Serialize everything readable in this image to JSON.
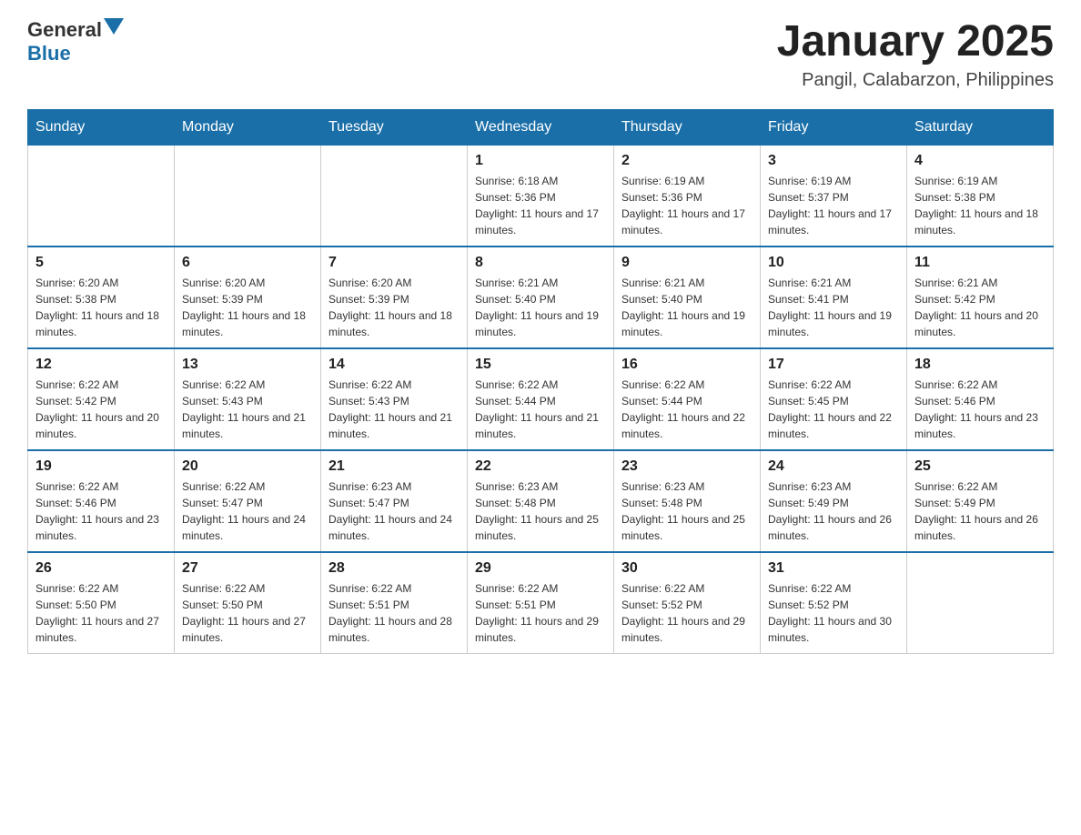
{
  "header": {
    "logo_general": "General",
    "logo_blue": "Blue",
    "month_title": "January 2025",
    "location": "Pangil, Calabarzon, Philippines"
  },
  "days_of_week": [
    "Sunday",
    "Monday",
    "Tuesday",
    "Wednesday",
    "Thursday",
    "Friday",
    "Saturday"
  ],
  "weeks": [
    {
      "cells": [
        {
          "day": "",
          "info": ""
        },
        {
          "day": "",
          "info": ""
        },
        {
          "day": "",
          "info": ""
        },
        {
          "day": "1",
          "info": "Sunrise: 6:18 AM\nSunset: 5:36 PM\nDaylight: 11 hours and 17 minutes."
        },
        {
          "day": "2",
          "info": "Sunrise: 6:19 AM\nSunset: 5:36 PM\nDaylight: 11 hours and 17 minutes."
        },
        {
          "day": "3",
          "info": "Sunrise: 6:19 AM\nSunset: 5:37 PM\nDaylight: 11 hours and 17 minutes."
        },
        {
          "day": "4",
          "info": "Sunrise: 6:19 AM\nSunset: 5:38 PM\nDaylight: 11 hours and 18 minutes."
        }
      ]
    },
    {
      "cells": [
        {
          "day": "5",
          "info": "Sunrise: 6:20 AM\nSunset: 5:38 PM\nDaylight: 11 hours and 18 minutes."
        },
        {
          "day": "6",
          "info": "Sunrise: 6:20 AM\nSunset: 5:39 PM\nDaylight: 11 hours and 18 minutes."
        },
        {
          "day": "7",
          "info": "Sunrise: 6:20 AM\nSunset: 5:39 PM\nDaylight: 11 hours and 18 minutes."
        },
        {
          "day": "8",
          "info": "Sunrise: 6:21 AM\nSunset: 5:40 PM\nDaylight: 11 hours and 19 minutes."
        },
        {
          "day": "9",
          "info": "Sunrise: 6:21 AM\nSunset: 5:40 PM\nDaylight: 11 hours and 19 minutes."
        },
        {
          "day": "10",
          "info": "Sunrise: 6:21 AM\nSunset: 5:41 PM\nDaylight: 11 hours and 19 minutes."
        },
        {
          "day": "11",
          "info": "Sunrise: 6:21 AM\nSunset: 5:42 PM\nDaylight: 11 hours and 20 minutes."
        }
      ]
    },
    {
      "cells": [
        {
          "day": "12",
          "info": "Sunrise: 6:22 AM\nSunset: 5:42 PM\nDaylight: 11 hours and 20 minutes."
        },
        {
          "day": "13",
          "info": "Sunrise: 6:22 AM\nSunset: 5:43 PM\nDaylight: 11 hours and 21 minutes."
        },
        {
          "day": "14",
          "info": "Sunrise: 6:22 AM\nSunset: 5:43 PM\nDaylight: 11 hours and 21 minutes."
        },
        {
          "day": "15",
          "info": "Sunrise: 6:22 AM\nSunset: 5:44 PM\nDaylight: 11 hours and 21 minutes."
        },
        {
          "day": "16",
          "info": "Sunrise: 6:22 AM\nSunset: 5:44 PM\nDaylight: 11 hours and 22 minutes."
        },
        {
          "day": "17",
          "info": "Sunrise: 6:22 AM\nSunset: 5:45 PM\nDaylight: 11 hours and 22 minutes."
        },
        {
          "day": "18",
          "info": "Sunrise: 6:22 AM\nSunset: 5:46 PM\nDaylight: 11 hours and 23 minutes."
        }
      ]
    },
    {
      "cells": [
        {
          "day": "19",
          "info": "Sunrise: 6:22 AM\nSunset: 5:46 PM\nDaylight: 11 hours and 23 minutes."
        },
        {
          "day": "20",
          "info": "Sunrise: 6:22 AM\nSunset: 5:47 PM\nDaylight: 11 hours and 24 minutes."
        },
        {
          "day": "21",
          "info": "Sunrise: 6:23 AM\nSunset: 5:47 PM\nDaylight: 11 hours and 24 minutes."
        },
        {
          "day": "22",
          "info": "Sunrise: 6:23 AM\nSunset: 5:48 PM\nDaylight: 11 hours and 25 minutes."
        },
        {
          "day": "23",
          "info": "Sunrise: 6:23 AM\nSunset: 5:48 PM\nDaylight: 11 hours and 25 minutes."
        },
        {
          "day": "24",
          "info": "Sunrise: 6:23 AM\nSunset: 5:49 PM\nDaylight: 11 hours and 26 minutes."
        },
        {
          "day": "25",
          "info": "Sunrise: 6:22 AM\nSunset: 5:49 PM\nDaylight: 11 hours and 26 minutes."
        }
      ]
    },
    {
      "cells": [
        {
          "day": "26",
          "info": "Sunrise: 6:22 AM\nSunset: 5:50 PM\nDaylight: 11 hours and 27 minutes."
        },
        {
          "day": "27",
          "info": "Sunrise: 6:22 AM\nSunset: 5:50 PM\nDaylight: 11 hours and 27 minutes."
        },
        {
          "day": "28",
          "info": "Sunrise: 6:22 AM\nSunset: 5:51 PM\nDaylight: 11 hours and 28 minutes."
        },
        {
          "day": "29",
          "info": "Sunrise: 6:22 AM\nSunset: 5:51 PM\nDaylight: 11 hours and 29 minutes."
        },
        {
          "day": "30",
          "info": "Sunrise: 6:22 AM\nSunset: 5:52 PM\nDaylight: 11 hours and 29 minutes."
        },
        {
          "day": "31",
          "info": "Sunrise: 6:22 AM\nSunset: 5:52 PM\nDaylight: 11 hours and 30 minutes."
        },
        {
          "day": "",
          "info": ""
        }
      ]
    }
  ]
}
